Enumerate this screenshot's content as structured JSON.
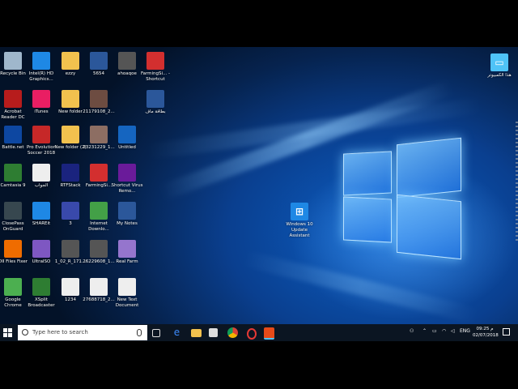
{
  "desktop_icons": [
    {
      "label": "Recycle Bin",
      "icon": "recycle-bin-icon",
      "color": "#9fb7cc"
    },
    {
      "label": "Intel(R) HD Graphics...",
      "icon": "intel-graphics-icon",
      "color": "#1e88e5"
    },
    {
      "label": "ezzy",
      "icon": "folder-icon",
      "color": "#f2c14e"
    },
    {
      "label": "5654",
      "icon": "word-doc-icon",
      "color": "#2b579a"
    },
    {
      "label": "ahoaqoe",
      "icon": "video-file-icon",
      "color": "#555555"
    },
    {
      "label": "FarmingSi... - Shortcut",
      "icon": "farming-simulator-icon",
      "color": "#d32f2f"
    },
    {
      "label": "Acrobat Reader DC",
      "icon": "acrobat-icon",
      "color": "#b71c1c"
    },
    {
      "label": "iTunes",
      "icon": "itunes-icon",
      "color": "#e91e63"
    },
    {
      "label": "New folder",
      "icon": "folder-icon",
      "color": "#f2c14e"
    },
    {
      "label": "21179108_2...",
      "icon": "image-file-icon",
      "color": "#6d4c41"
    },
    {
      "label": "بطاقة ماف",
      "icon": "word-doc-icon",
      "color": "#2b579a"
    },
    {
      "label": "Battle.net",
      "icon": "battlenet-icon",
      "color": "#0d47a1"
    },
    {
      "label": "Pro Evolution Soccer 2018",
      "icon": "pes-icon",
      "color": "#c62828"
    },
    {
      "label": "New folder (2)",
      "icon": "folder-icon",
      "color": "#f2c14e"
    },
    {
      "label": "23231229_1...",
      "icon": "image-file-icon",
      "color": "#8d6e63"
    },
    {
      "label": "Untitled",
      "icon": "untitled-icon",
      "color": "#1565c0"
    },
    {
      "label": "Camtasia 9",
      "icon": "camtasia-icon",
      "color": "#2e7d32"
    },
    {
      "label": "الجواب",
      "icon": "document-icon",
      "color": "#eeeeee"
    },
    {
      "label": "RTFStack",
      "icon": "rtfstack-icon",
      "color": "#1a237e"
    },
    {
      "label": "FarmingSi...",
      "icon": "farming-simulator-icon",
      "color": "#d32f2f"
    },
    {
      "label": "Shortcut Virus Remo...",
      "icon": "virus-remover-icon",
      "color": "#6a1b9a"
    },
    {
      "label": "ClosePass OnGuard",
      "icon": "onguard-icon",
      "color": "#37474f"
    },
    {
      "label": "SHAREit",
      "icon": "shareit-icon",
      "color": "#1e88e5"
    },
    {
      "label": "3",
      "icon": "image-file-icon",
      "color": "#3949ab"
    },
    {
      "label": "Internet Downlo...",
      "icon": "idm-icon",
      "color": "#43a047"
    },
    {
      "label": "My Notes",
      "icon": "word-doc-icon",
      "color": "#2b579a"
    },
    {
      "label": "DII Files Fixer",
      "icon": "dll-fixer-icon",
      "color": "#ef6c00"
    },
    {
      "label": "UltraISO",
      "icon": "ultraiso-icon",
      "color": "#7e57c2"
    },
    {
      "label": "1_02_R_171...",
      "icon": "video-file-icon",
      "color": "#555555"
    },
    {
      "label": "26229608_1...",
      "icon": "video-file-icon",
      "color": "#555555"
    },
    {
      "label": "Real Farm",
      "icon": "disc-icon",
      "color": "#9575cd"
    },
    {
      "label": "Google Chrome",
      "icon": "chrome-icon",
      "color": "#4caf50"
    },
    {
      "label": "XSplit Broadcaster",
      "icon": "xsplit-icon",
      "color": "#2e7d32"
    },
    {
      "label": "1234",
      "icon": "blank-file-icon",
      "color": "#eeeeee"
    },
    {
      "label": "27688718_2...",
      "icon": "document-icon",
      "color": "#eeeeee"
    },
    {
      "label": "New Text Document",
      "icon": "text-file-icon",
      "color": "#eeeeee"
    }
  ],
  "right_icons": [
    {
      "label": "هذا الكمبيوتر",
      "icon": "this-pc-icon",
      "color": "#4fc3f7"
    },
    {
      "label": "Windows 10 Update Assistant",
      "icon": "windows-update-icon",
      "color": "#1e88e5"
    }
  ],
  "taskbar": {
    "search_placeholder": "Type here to search",
    "lang": "ENG",
    "time": "09:25 م",
    "date": "02/07/2018"
  }
}
